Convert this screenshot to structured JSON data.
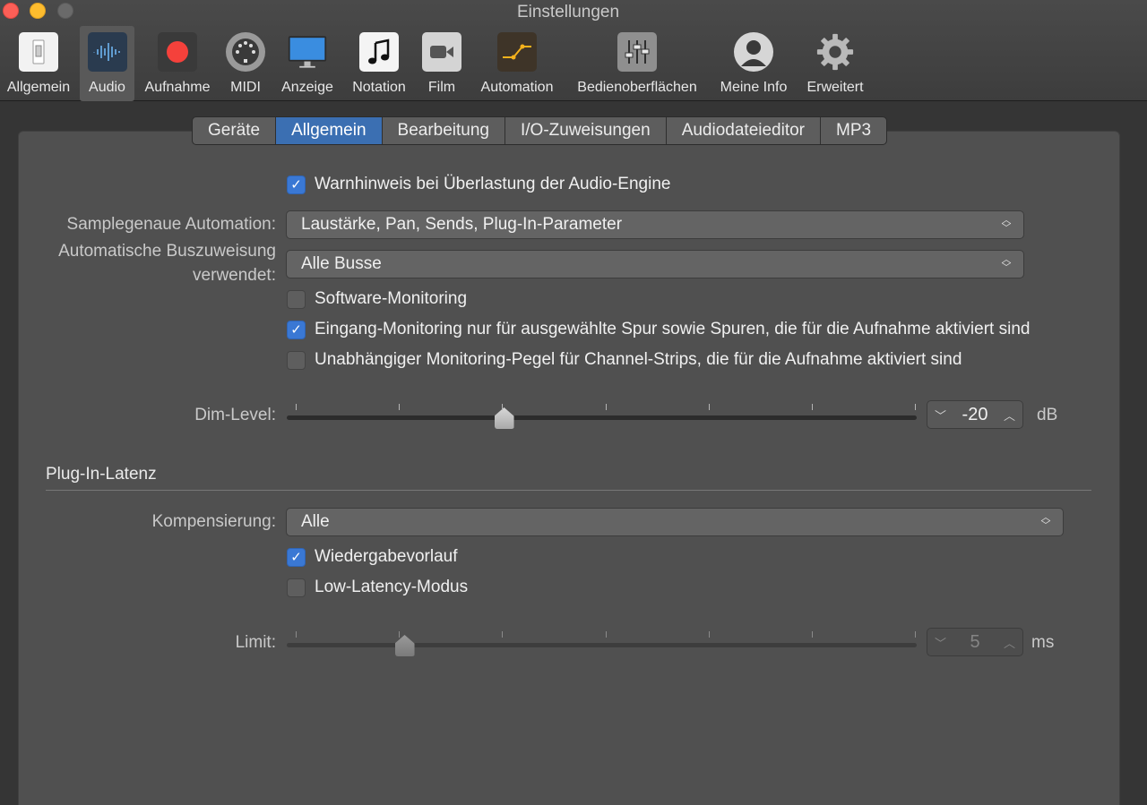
{
  "window": {
    "title": "Einstellungen"
  },
  "toolbar": {
    "items": [
      {
        "label": "Allgemein",
        "icon": "switch-icon"
      },
      {
        "label": "Audio",
        "icon": "waveform-icon",
        "selected": true
      },
      {
        "label": "Aufnahme",
        "icon": "record-icon"
      },
      {
        "label": "MIDI",
        "icon": "midi-connector-icon"
      },
      {
        "label": "Anzeige",
        "icon": "display-icon"
      },
      {
        "label": "Notation",
        "icon": "music-note-icon"
      },
      {
        "label": "Film",
        "icon": "video-camera-icon"
      },
      {
        "label": "Automation",
        "icon": "automation-curve-icon"
      },
      {
        "label": "Bedienoberflächen",
        "icon": "faders-icon"
      },
      {
        "label": "Meine Info",
        "icon": "user-icon"
      },
      {
        "label": "Erweitert",
        "icon": "gear-icon"
      }
    ]
  },
  "tabs": [
    "Geräte",
    "Allgemein",
    "Bearbeitung",
    "I/O-Zuweisungen",
    "Audiodateieditor",
    "MP3"
  ],
  "active_tab": "Allgemein",
  "form": {
    "overload_warning": {
      "label": "Warnhinweis bei Überlastung der Audio-Engine",
      "checked": true
    },
    "sample_automation": {
      "label": "Samplegenaue Automation:",
      "value": "Laustärke, Pan, Sends, Plug-In-Parameter"
    },
    "auto_bus": {
      "label_line1": "Automatische Buszuweisung",
      "label_line2": "verwendet:",
      "value": "Alle Busse"
    },
    "software_monitoring": {
      "label": "Software-Monitoring",
      "checked": false
    },
    "input_monitoring": {
      "label": "Eingang-Monitoring nur für ausgewählte Spur sowie Spuren, die für die Aufnahme aktiviert sind",
      "checked": true
    },
    "independent_level": {
      "label": "Unabhängiger Monitoring-Pegel für Channel-Strips, die für die Aufnahme aktiviert sind",
      "checked": false
    },
    "dim_level": {
      "label": "Dim-Level:",
      "value": "-20",
      "unit": "dB",
      "slider_fraction": 0.34
    }
  },
  "latency": {
    "section_title": "Plug-In-Latenz",
    "compensation": {
      "label": "Kompensierung:",
      "value": "Alle"
    },
    "playback_preroll": {
      "label": "Wiedergabevorlauf",
      "checked": true
    },
    "low_latency": {
      "label": "Low-Latency-Modus",
      "checked": false
    },
    "limit": {
      "label": "Limit:",
      "value": "5",
      "unit": "ms",
      "slider_fraction": 0.177,
      "enabled": false
    }
  },
  "colors": {
    "accent": "#3a78d4",
    "tab_active": "#3b6fb2",
    "record_red": "#f5413b"
  }
}
